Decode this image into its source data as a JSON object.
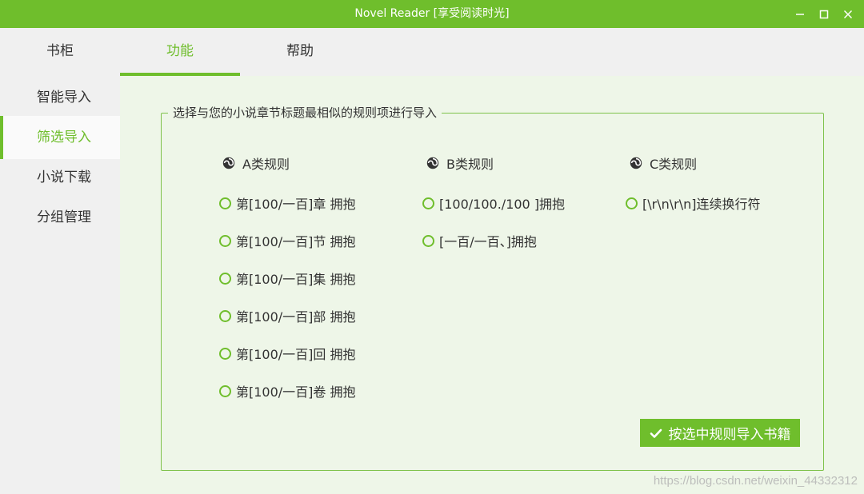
{
  "window": {
    "title": "Novel Reader [享受阅读时光]",
    "controls": [
      "minimize-icon",
      "maximize-icon",
      "close-icon"
    ],
    "accent_color": "#6fbe2c"
  },
  "tabs": [
    {
      "label": "书柜",
      "active": false
    },
    {
      "label": "功能",
      "active": true
    },
    {
      "label": "帮助",
      "active": false
    }
  ],
  "sidebar": {
    "items": [
      {
        "label": "智能导入",
        "active": false
      },
      {
        "label": "筛选导入",
        "active": true
      },
      {
        "label": "小说下载",
        "active": false
      },
      {
        "label": "分组管理",
        "active": false
      }
    ]
  },
  "rules": {
    "legend": "选择与您的小说章节标题最相似的规则项进行导入",
    "columns": [
      {
        "header": "A类规则",
        "options": [
          "第[100/一百]章 拥抱",
          "第[100/一百]节 拥抱",
          "第[100/一百]集 拥抱",
          "第[100/一百]部 拥抱",
          "第[100/一百]回 拥抱",
          "第[100/一百]卷 拥抱"
        ]
      },
      {
        "header": "B类规则",
        "options": [
          "[100/100./100 ]拥抱",
          "[一百/一百、]拥抱"
        ]
      },
      {
        "header": "C类规则",
        "options": [
          "[\\r\\n\\r\\n]连续换行符"
        ]
      }
    ],
    "import_button": "按选中规则导入书籍"
  },
  "watermark": "https://blog.csdn.net/weixin_44332312"
}
